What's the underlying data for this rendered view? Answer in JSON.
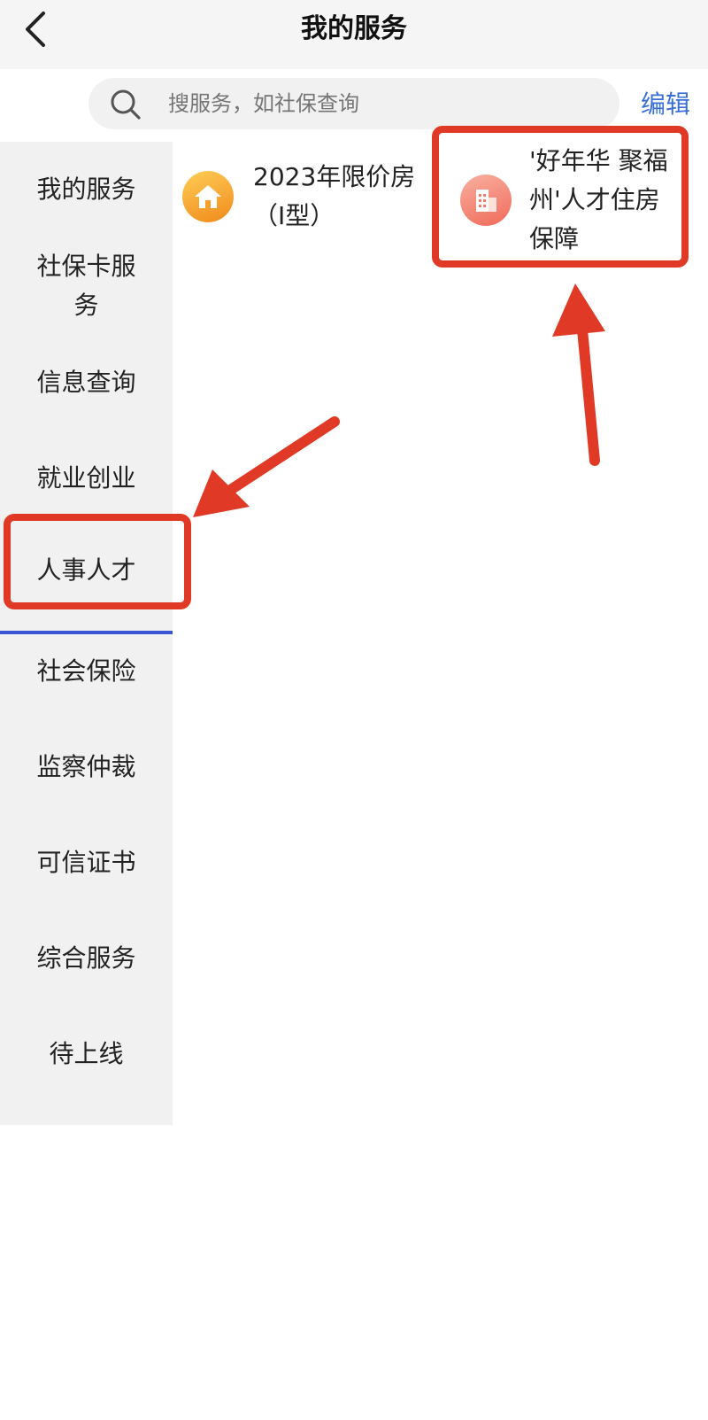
{
  "header": {
    "title": "我的服务"
  },
  "search": {
    "placeholder": "搜服务，如社保查询",
    "edit_label": "编辑"
  },
  "sidebar": {
    "items": [
      {
        "label": "我的服务"
      },
      {
        "label": "社保卡服务"
      },
      {
        "label": "信息查询"
      },
      {
        "label": "就业创业"
      },
      {
        "label": "人事人才"
      },
      {
        "label": "社会保险"
      },
      {
        "label": "监察仲裁"
      },
      {
        "label": "可信证书"
      },
      {
        "label": "综合服务"
      },
      {
        "label": "待上线"
      }
    ],
    "active_index": 4
  },
  "services": [
    {
      "label": "2023年限价房（I型）",
      "icon": "house-icon",
      "color": "#f08a1c"
    },
    {
      "label": "'好年华 聚福州'人才住房保障",
      "icon": "building-icon",
      "color": "#f06a5a"
    }
  ],
  "colors": {
    "accent": "#3a6fd8",
    "annotation": "#e03a27"
  }
}
